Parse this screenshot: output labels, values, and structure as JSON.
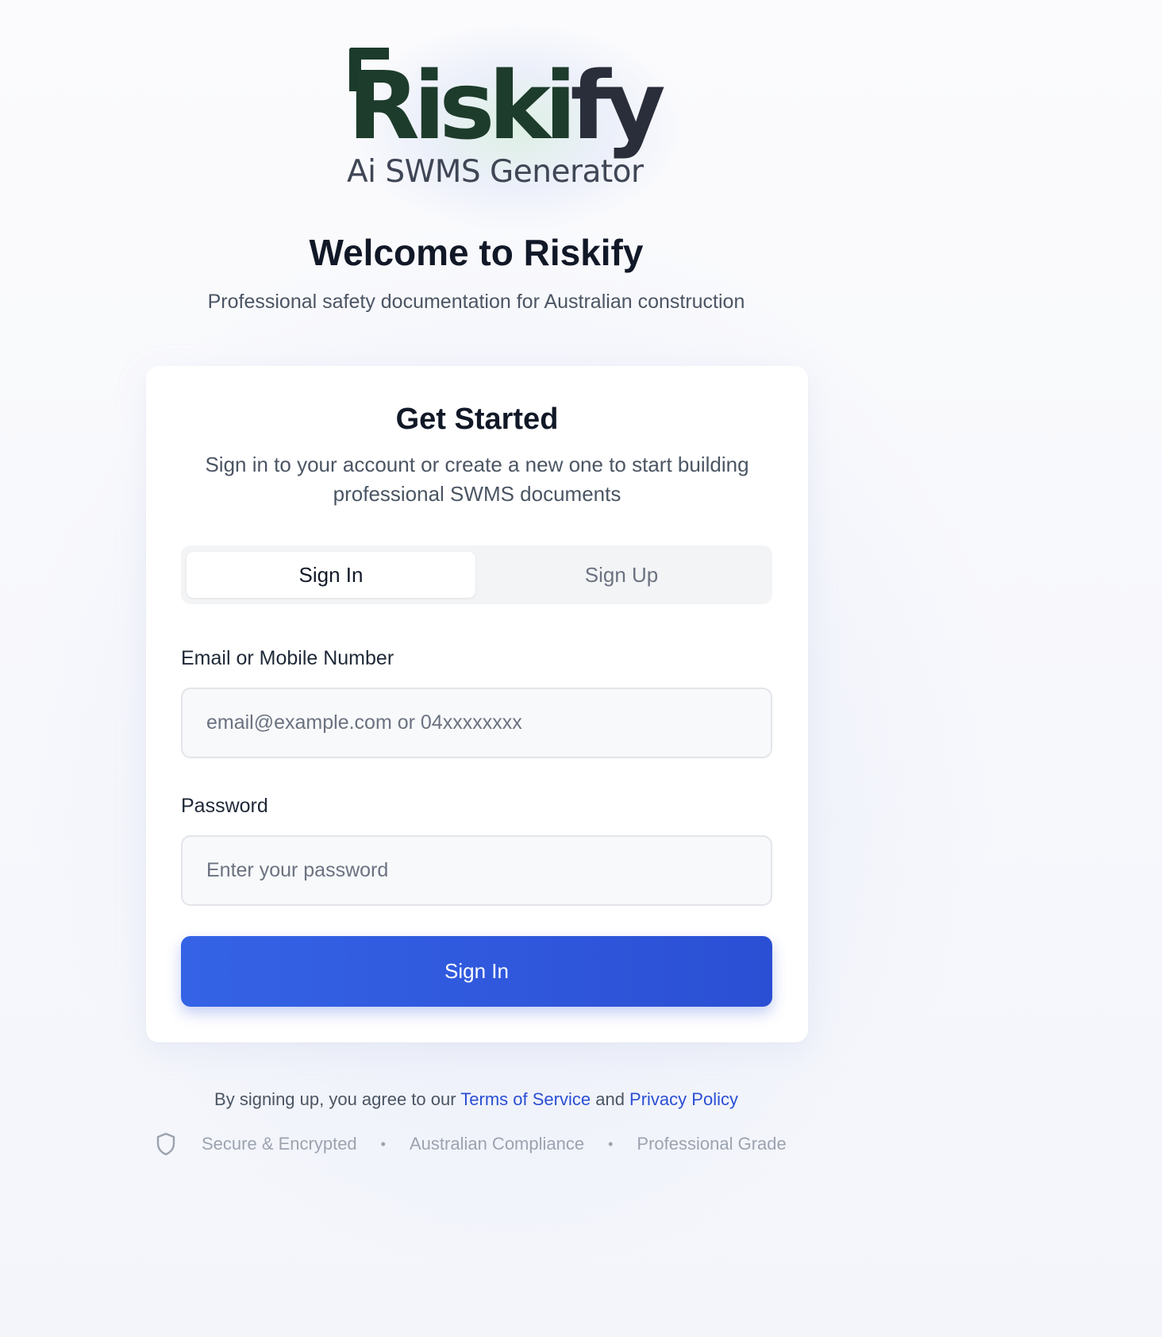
{
  "logo": {
    "brand_main": "Riski",
    "brand_end": "fy",
    "tagline": "Ai SWMS Generator"
  },
  "header": {
    "title": "Welcome to Riskify",
    "subtitle": "Professional safety documentation for Australian construction"
  },
  "card": {
    "title": "Get Started",
    "description": "Sign in to your account or create a new one to start building professional SWMS documents",
    "tabs": [
      {
        "label": "Sign In",
        "active": true
      },
      {
        "label": "Sign Up",
        "active": false
      }
    ],
    "email": {
      "label": "Email or Mobile Number",
      "value": "",
      "placeholder": "email@example.com or 04xxxxxxxx"
    },
    "password": {
      "label": "Password",
      "value": "",
      "placeholder": "Enter your password"
    },
    "submit_label": "Sign In"
  },
  "footer": {
    "terms_prefix": "By signing up, you agree to our ",
    "terms_link": "Terms of Service",
    "terms_and": " and ",
    "privacy_link": "Privacy Policy",
    "badges": [
      "Secure & Encrypted",
      "Australian Compliance",
      "Professional Grade"
    ],
    "separator": "•",
    "badge_icon": "shield-icon"
  },
  "colors": {
    "brand_green": "#1d3c2c",
    "primary_blue": "#2b4fd4",
    "link_blue": "#2b4fd4",
    "text_dark": "#111827",
    "text_muted": "#4b5563"
  }
}
